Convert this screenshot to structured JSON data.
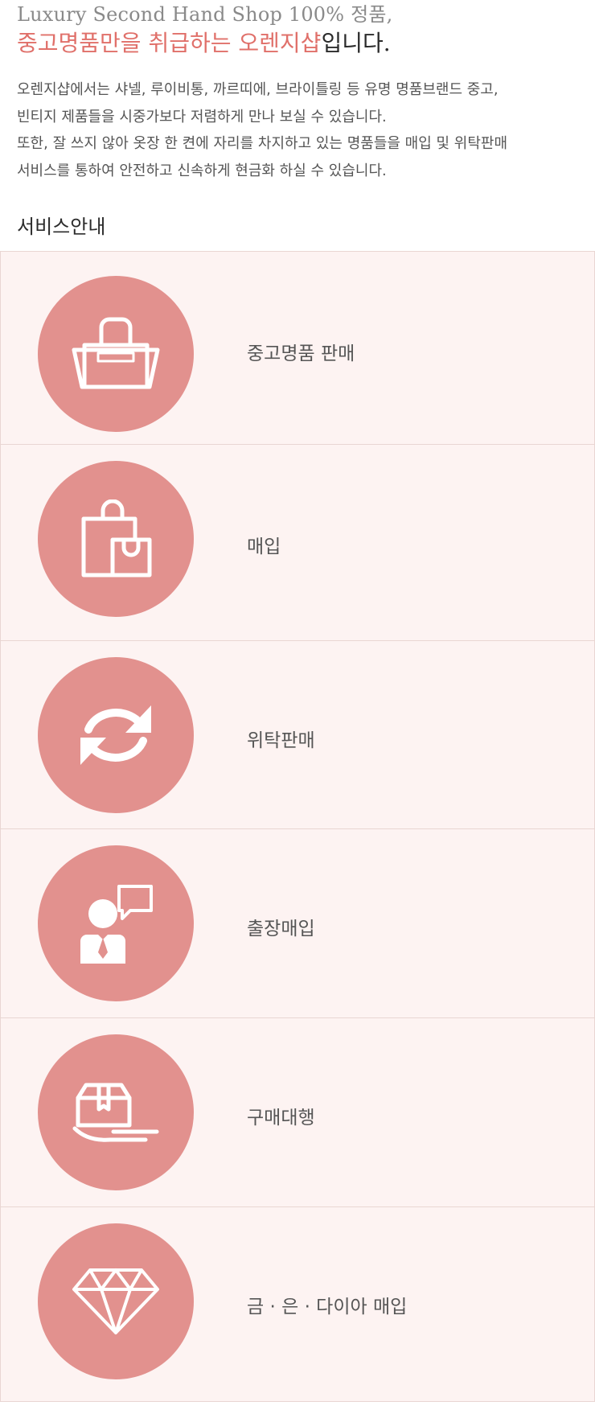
{
  "intro": {
    "subtitle": "Luxury Second Hand Shop 100% 정품,",
    "title_accent": "중고명품만을 취급하는 오렌지샵",
    "title_rest": "입니다.",
    "desc_lines": [
      "오렌지샵에서는 샤넬, 루이비통, 까르띠에, 브라이틀링 등 유명 명품브랜드 중고,",
      "빈티지 제품들을 시중가보다 저렴하게 만나 보실 수 있습니다.",
      "또한, 잘 쓰지 않아 옷장 한 켠에 자리를 차지하고 있는 명품들을 매입 및 위탁판매",
      "서비스를 통하여 안전하고 신속하게 현금화 하실 수 있습니다."
    ]
  },
  "section": {
    "heading": "서비스안내"
  },
  "services": [
    {
      "label": "중고명품 판매",
      "icon": "handbag-icon"
    },
    {
      "label": "매입",
      "icon": "shopping-bags-icon"
    },
    {
      "label": "위탁판매",
      "icon": "refresh-icon"
    },
    {
      "label": "출장매입",
      "icon": "consultant-icon"
    },
    {
      "label": "구매대행",
      "icon": "package-hand-icon"
    },
    {
      "label": "금 · 은 · 다이아 매입",
      "icon": "diamond-icon"
    }
  ],
  "colors": {
    "accent": "#e0706a",
    "circle": "#e2918e",
    "row_bg": "#fdf3f2",
    "border": "#e9d6d3"
  }
}
